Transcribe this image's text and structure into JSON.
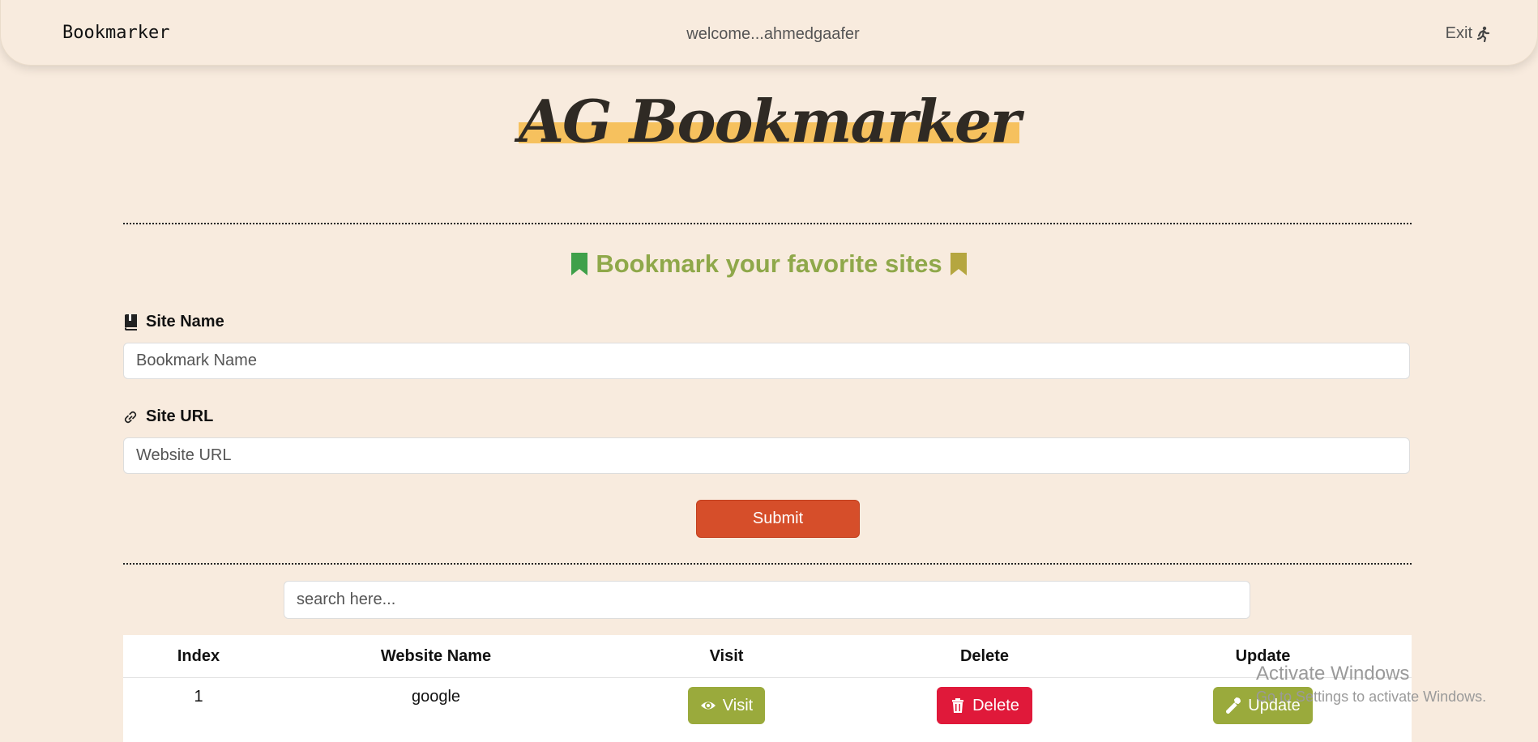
{
  "navbar": {
    "brand": "Bookmarker",
    "welcome": "welcome...ahmedgaafer",
    "exit_label": "Exit",
    "exit_icon": "running-person-icon"
  },
  "hero": {
    "title": "AG Bookmarker",
    "highlight_color": "#f6c15e"
  },
  "form": {
    "heading": "Bookmark your favorite sites",
    "heading_icon_left": "bookmark-icon",
    "heading_icon_right": "bookmark-icon",
    "site_name": {
      "label": "Site Name",
      "icon": "book-icon",
      "placeholder": "Bookmark Name",
      "value": ""
    },
    "site_url": {
      "label": "Site URL",
      "icon": "link-icon",
      "placeholder": "Website URL",
      "value": ""
    },
    "submit_label": "Submit"
  },
  "search": {
    "placeholder": "search here...",
    "value": ""
  },
  "table": {
    "headers": [
      "Index",
      "Website Name",
      "Visit",
      "Delete",
      "Update"
    ],
    "rows": [
      {
        "index": "1",
        "name": "google",
        "visit_label": "Visit",
        "delete_label": "Delete",
        "update_label": "Update"
      }
    ]
  },
  "watermark": {
    "title": "Activate Windows",
    "subtitle": "Go to Settings to activate Windows."
  },
  "colors": {
    "background": "#f8ebde",
    "accent_green": "#8fa84a",
    "submit": "#d64e2a",
    "delete": "#e0193a",
    "button_green": "#9aaa3c",
    "bookmark_left": "#3fa04a",
    "bookmark_right": "#b5a640"
  }
}
